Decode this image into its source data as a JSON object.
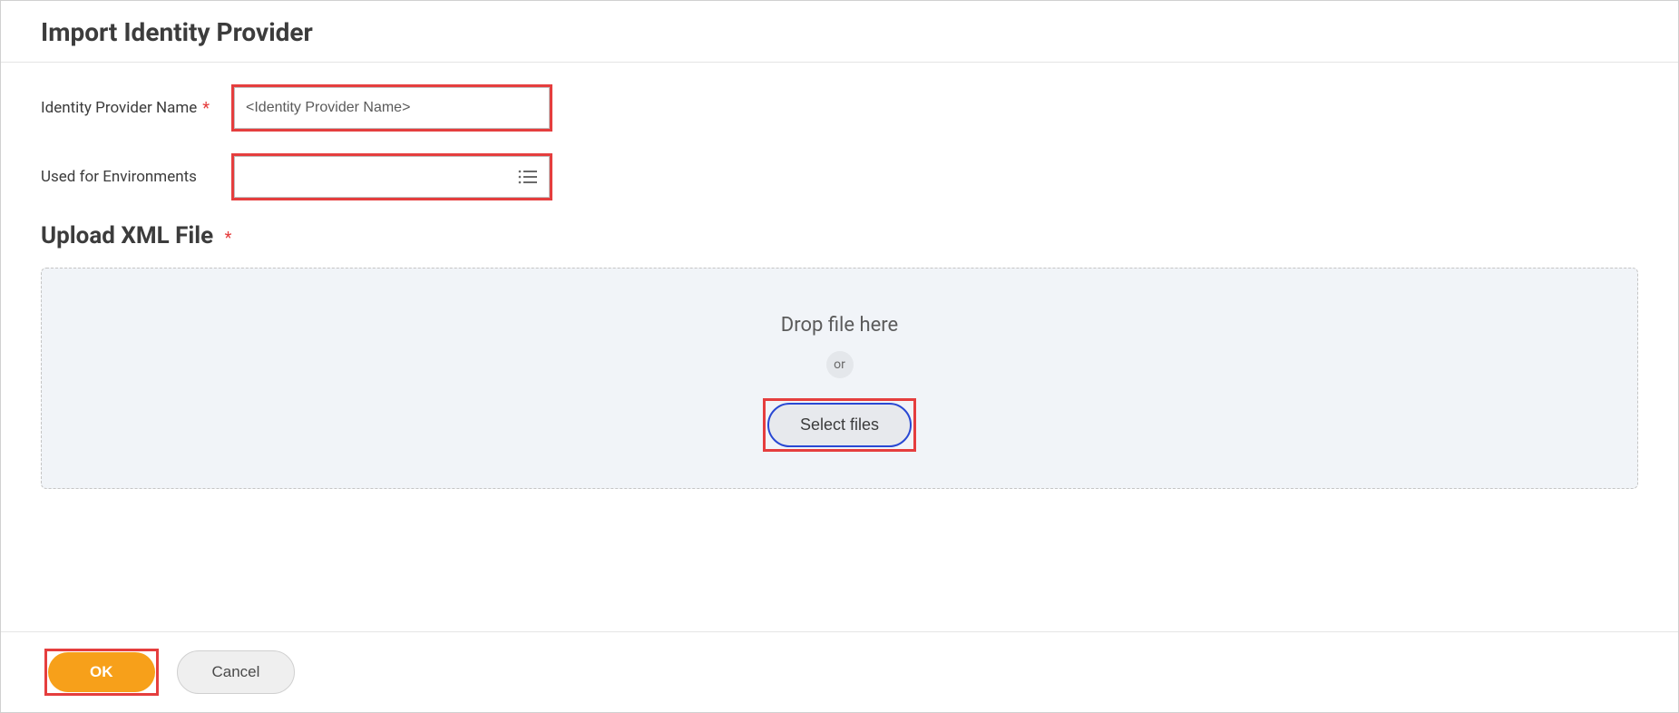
{
  "header": {
    "title": "Import Identity Provider"
  },
  "form": {
    "nameLabel": "Identity Provider Name",
    "nameValue": "<Identity Provider Name>",
    "envLabel": "Used for Environments",
    "envValue": ""
  },
  "upload": {
    "sectionTitle": "Upload XML File",
    "dropText": "Drop file here",
    "orText": "or",
    "selectFilesLabel": "Select files"
  },
  "footer": {
    "okLabel": "OK",
    "cancelLabel": "Cancel"
  }
}
